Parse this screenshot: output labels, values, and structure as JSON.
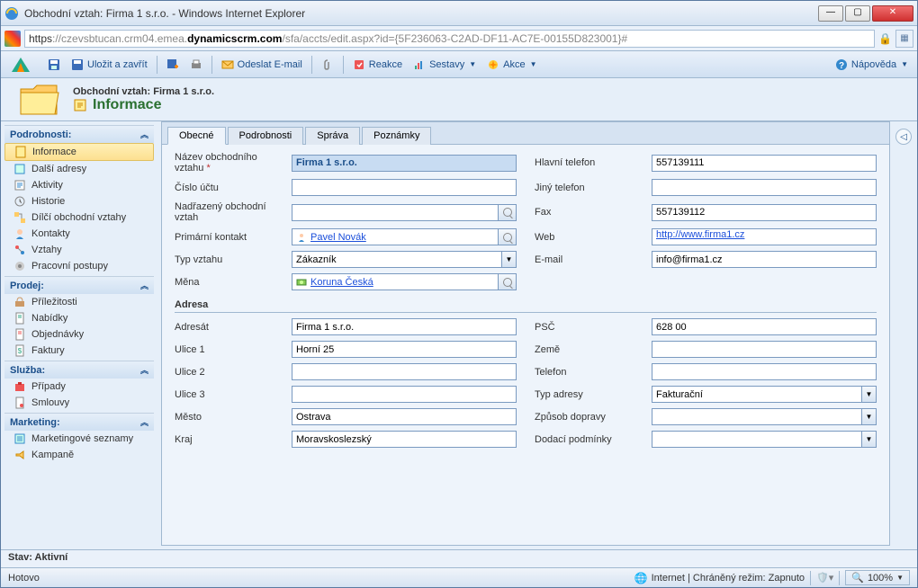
{
  "window": {
    "title": "Obchodní vztah: Firma 1 s.r.o. - Windows Internet Explorer",
    "url_prefix": "https",
    "url_host_gray1": "://czevsbtucan.crm04.emea.",
    "url_host_bold": "dynamicscrm.com",
    "url_path": "/sfa/accts/edit.aspx?id={5F236063-C2AD-DF11-AC7E-00155D823001}#"
  },
  "toolbar": {
    "save_close": "Uložit a zavřít",
    "send_email": "Odeslat E-mail",
    "reactions": "Reakce",
    "reports": "Sestavy",
    "actions": "Akce",
    "help": "Nápověda"
  },
  "header": {
    "subtitle": "Obchodní vztah: Firma 1 s.r.o.",
    "title": "Informace"
  },
  "tabs": [
    "Obecné",
    "Podrobnosti",
    "Správa",
    "Poznámky"
  ],
  "sidebar": {
    "groups": [
      {
        "title": "Podrobnosti:",
        "items": [
          "Informace",
          "Další adresy",
          "Aktivity",
          "Historie",
          "Dílčí obchodní vztahy",
          "Kontakty",
          "Vztahy",
          "Pracovní postupy"
        ],
        "active": 0
      },
      {
        "title": "Prodej:",
        "items": [
          "Příležitosti",
          "Nabídky",
          "Objednávky",
          "Faktury"
        ]
      },
      {
        "title": "Služba:",
        "items": [
          "Případy",
          "Smlouvy"
        ]
      },
      {
        "title": "Marketing:",
        "items": [
          "Marketingové seznamy",
          "Kampaně"
        ]
      }
    ]
  },
  "form": {
    "labels": {
      "name": "Název obchodního vztahu",
      "accno": "Číslo účtu",
      "parent": "Nadřazený obchodní vztah",
      "primary_contact": "Primární kontakt",
      "rel_type": "Typ vztahu",
      "currency": "Měna",
      "main_phone": "Hlavní telefon",
      "other_phone": "Jiný telefon",
      "fax": "Fax",
      "web": "Web",
      "email": "E-mail",
      "address_section": "Adresa",
      "addressee": "Adresát",
      "street1": "Ulice 1",
      "street2": "Ulice 2",
      "street3": "Ulice 3",
      "city": "Město",
      "region": "Kraj",
      "zip": "PSČ",
      "country": "Země",
      "phone": "Telefon",
      "addr_type": "Typ adresy",
      "ship_method": "Způsob dopravy",
      "delivery_terms": "Dodací podmínky"
    },
    "values": {
      "name": "Firma 1 s.r.o.",
      "accno": "",
      "parent": "",
      "primary_contact": "Pavel Novák",
      "rel_type": "Zákazník",
      "currency": "Koruna Česká",
      "main_phone": "557139111",
      "other_phone": "",
      "fax": "557139112",
      "web": "http://www.firma1.cz",
      "email": "info@firma1.cz",
      "addressee": "Firma 1 s.r.o.",
      "street1": "Horní 25",
      "street2": "",
      "street3": "",
      "city": "Ostrava",
      "region": "Moravskoslezský",
      "zip": "628 00",
      "country": "",
      "phone": "",
      "addr_type": "Fakturační",
      "ship_method": "",
      "delivery_terms": ""
    }
  },
  "status": {
    "crm": "Stav: Aktivní",
    "ie_left": "Hotovo",
    "ie_mid": "Internet | Chráněný režim: Zapnuto",
    "zoom": "100%"
  }
}
